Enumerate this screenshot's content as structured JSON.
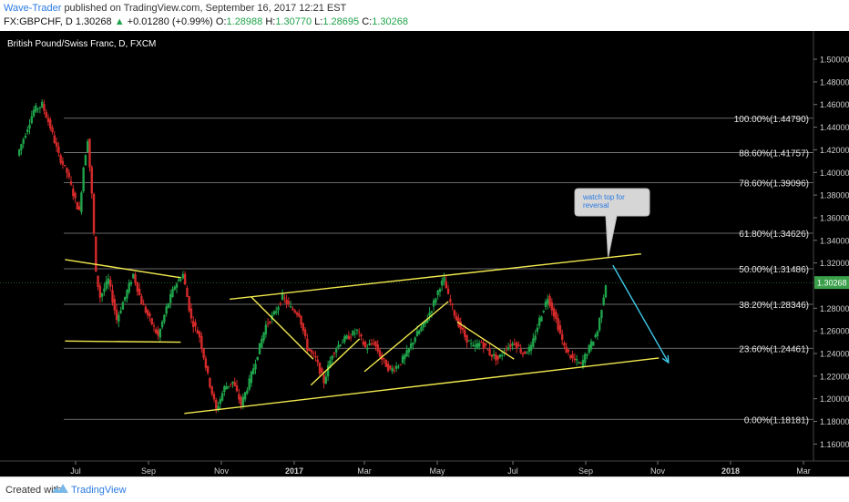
{
  "header": {
    "author": "Wave-Trader",
    "published": "published on TradingView.com, September 16, 2017 12:21 EST",
    "symbol": "FX:GBPCHF, D",
    "last": "1.30268",
    "arrow": "▲",
    "change": "+0.01280 (+0.99%)",
    "o_label": "O:",
    "o": "1.28988",
    "h_label": "H:",
    "h": "1.30770",
    "l_label": "L:",
    "l": "1.28695",
    "c_label": "C:",
    "c": "1.30268"
  },
  "colors": {
    "background": "#000000",
    "up": "#1fa34a",
    "down": "#d62a2a",
    "fib": "#8a8a8a",
    "trend": "#f2e94e",
    "arrow": "#3ec8e8",
    "price_tag": "#3aa04a"
  },
  "chart_data": {
    "type": "candlestick",
    "title": "British Pound/Swiss Franc, D, FXCM",
    "x_ticks": [
      "Jul",
      "Sep",
      "Nov",
      "2017",
      "Mar",
      "May",
      "Jul",
      "Sep",
      "Nov",
      "2018",
      "Mar"
    ],
    "y_ticks": [
      "1.50000",
      "1.48000",
      "1.46000",
      "1.44000",
      "1.42000",
      "1.40000",
      "1.38000",
      "1.36000",
      "1.34000",
      "1.32000",
      "1.28000",
      "1.26000",
      "1.24000",
      "1.22000",
      "1.20000",
      "1.18000",
      "1.16000"
    ],
    "ylim": [
      1.145,
      1.525
    ],
    "last_price_label": "1.30268",
    "last_price": 1.30268,
    "fib_levels": [
      {
        "label": "100.00%(1.44790)",
        "value": 1.4479
      },
      {
        "label": "88.60%(1.41757)",
        "value": 1.41757
      },
      {
        "label": "78.60%(1.39096)",
        "value": 1.39096
      },
      {
        "label": "61.80%(1.34626)",
        "value": 1.34626
      },
      {
        "label": "50.00%(1.31486)",
        "value": 1.31486
      },
      {
        "label": "38.20%(1.28346)",
        "value": 1.28346
      },
      {
        "label": "23.60%(1.24461)",
        "value": 1.24461
      },
      {
        "label": "0.00%(1.18181)",
        "value": 1.18181
      }
    ],
    "price_path": [
      [
        0,
        1.415
      ],
      [
        2,
        1.435
      ],
      [
        4,
        1.455
      ],
      [
        6,
        1.46
      ],
      [
        8,
        1.44
      ],
      [
        10,
        1.415
      ],
      [
        12,
        1.4
      ],
      [
        14,
        1.375
      ],
      [
        15,
        1.365
      ],
      [
        16,
        1.405
      ],
      [
        17,
        1.43
      ],
      [
        18,
        1.38
      ],
      [
        19,
        1.31
      ],
      [
        20,
        1.29
      ],
      [
        22,
        1.305
      ],
      [
        24,
        1.27
      ],
      [
        26,
        1.29
      ],
      [
        28,
        1.31
      ],
      [
        30,
        1.285
      ],
      [
        32,
        1.27
      ],
      [
        34,
        1.255
      ],
      [
        36,
        1.28
      ],
      [
        38,
        1.3
      ],
      [
        40,
        1.31
      ],
      [
        42,
        1.27
      ],
      [
        44,
        1.255
      ],
      [
        46,
        1.22
      ],
      [
        48,
        1.19
      ],
      [
        50,
        1.21
      ],
      [
        52,
        1.215
      ],
      [
        54,
        1.195
      ],
      [
        56,
        1.215
      ],
      [
        58,
        1.24
      ],
      [
        60,
        1.265
      ],
      [
        62,
        1.275
      ],
      [
        64,
        1.29
      ],
      [
        66,
        1.28
      ],
      [
        68,
        1.275
      ],
      [
        70,
        1.245
      ],
      [
        72,
        1.235
      ],
      [
        74,
        1.215
      ],
      [
        76,
        1.24
      ],
      [
        78,
        1.25
      ],
      [
        80,
        1.255
      ],
      [
        82,
        1.26
      ],
      [
        84,
        1.245
      ],
      [
        86,
        1.25
      ],
      [
        88,
        1.235
      ],
      [
        90,
        1.225
      ],
      [
        92,
        1.23
      ],
      [
        94,
        1.24
      ],
      [
        96,
        1.255
      ],
      [
        98,
        1.265
      ],
      [
        100,
        1.28
      ],
      [
        102,
        1.3
      ],
      [
        103,
        1.305
      ],
      [
        104,
        1.29
      ],
      [
        106,
        1.27
      ],
      [
        108,
        1.255
      ],
      [
        110,
        1.245
      ],
      [
        112,
        1.25
      ],
      [
        114,
        1.24
      ],
      [
        116,
        1.235
      ],
      [
        118,
        1.245
      ],
      [
        120,
        1.25
      ],
      [
        122,
        1.24
      ],
      [
        124,
        1.245
      ],
      [
        126,
        1.27
      ],
      [
        128,
        1.29
      ],
      [
        130,
        1.27
      ],
      [
        132,
        1.245
      ],
      [
        134,
        1.235
      ],
      [
        136,
        1.23
      ],
      [
        138,
        1.245
      ],
      [
        140,
        1.26
      ],
      [
        142,
        1.302
      ]
    ],
    "trendlines": [
      {
        "x1": "2016-06-22",
        "y1": 1.323,
        "x2": "2016-09-28",
        "y2": 1.307
      },
      {
        "x1": "2016-06-22",
        "y1": 1.251,
        "x2": "2016-09-28",
        "y2": 1.25
      },
      {
        "x1": "2016-10-01",
        "y1": 1.187,
        "x2": "2017-11-02",
        "y2": 1.236
      },
      {
        "x1": "2016-11-08",
        "y1": 1.288,
        "x2": "2017-10-18",
        "y2": 1.328
      },
      {
        "x1": "2016-11-26",
        "y1": 1.29,
        "x2": "2017-01-17",
        "y2": 1.235
      },
      {
        "x1": "2017-01-15",
        "y1": 1.212,
        "x2": "2017-02-25",
        "y2": 1.253
      },
      {
        "x1": "2017-03-01",
        "y1": 1.224,
        "x2": "2017-05-10",
        "y2": 1.286
      },
      {
        "x1": "2017-05-17",
        "y1": 1.268,
        "x2": "2017-07-02",
        "y2": 1.235
      }
    ],
    "projection_arrow": {
      "x1": "2017-09-24",
      "y1": 1.318,
      "x2": "2017-11-10",
      "y2": 1.232
    },
    "callout": {
      "text": "watch top for reversal",
      "x": "2017-09-20",
      "y": 1.325
    }
  },
  "footer": {
    "created": "Created with",
    "brand": "TradingView"
  }
}
